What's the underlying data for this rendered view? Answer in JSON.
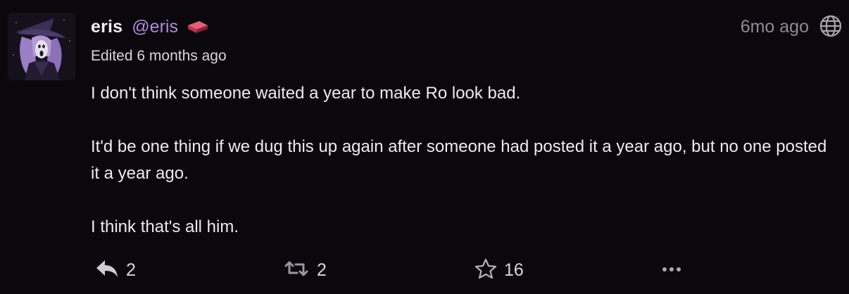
{
  "author": {
    "display_name": "eris",
    "handle": "@eris",
    "badge_icon": "brick-icon"
  },
  "meta": {
    "edited_text": "Edited 6 months ago",
    "relative_time": "6mo ago",
    "visibility_icon": "globe-icon"
  },
  "content": {
    "paragraphs": [
      "I don't think someone waited a year to make Ro look bad.",
      "It'd be one thing if we dug this up again after someone had posted it a year ago, but no one posted it a year ago.",
      "I think that's all him."
    ]
  },
  "actions": {
    "reply_count": "2",
    "boost_count": "2",
    "favourite_count": "16"
  },
  "colors": {
    "background": "#0b080d",
    "handle": "#b08be0",
    "text": "#ecebee",
    "muted": "#8f8b94"
  }
}
